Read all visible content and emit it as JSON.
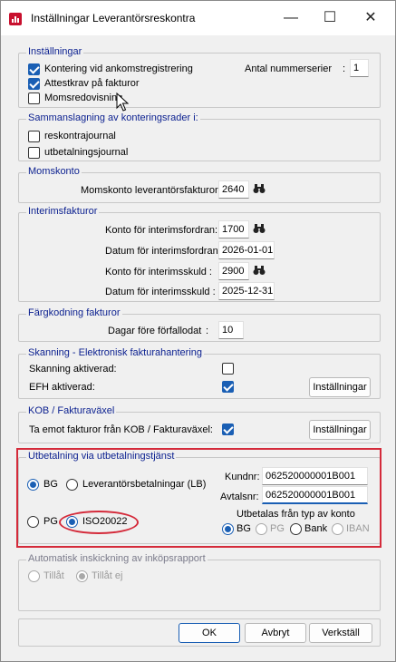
{
  "window": {
    "title": "Inställningar Leverantörsreskontra",
    "minimize_glyph": "—",
    "maximize_glyph": "☐",
    "close_glyph": "✕"
  },
  "installningar": {
    "title": "Inställningar",
    "kontering_label": "Kontering vid ankomstregistrering",
    "kontering_checked": true,
    "attestkrav_label": "Attestkrav på fakturor",
    "attestkrav_checked": true,
    "momsredovisning_label": "Momsredovisning",
    "momsredovisning_checked": false,
    "antal_label": "Antal nummerserier",
    "antal_colon": ":",
    "antal_value": "1"
  },
  "sammanslagning": {
    "title": "Sammanslagning av konteringsrader i:",
    "reskontra_label": "reskontrajournal",
    "utbetalning_label": "utbetalningsjournal"
  },
  "momskonto": {
    "title": "Momskonto",
    "label": "Momskonto leverantörsfakturor:",
    "value": "2640"
  },
  "interims": {
    "title": "Interimsfakturor",
    "konto_fordran_label": "Konto för interimsfordran:",
    "konto_fordran_value": "1700",
    "datum_fordran_label": "Datum för interimsfordran:",
    "datum_fordran_value": "2026-01-01",
    "konto_skuld_label": "Konto för interimsskuld :",
    "konto_skuld_value": "2900",
    "datum_skuld_label": "Datum för interimsskuld :",
    "datum_skuld_value": "2025-12-31"
  },
  "fargkodning": {
    "title": "Färgkodning fakturor",
    "label": "Dagar före förfallodat",
    "colon": ":",
    "value": "10"
  },
  "skanning": {
    "title": "Skanning -  Elektronisk fakturahantering",
    "aktiverad_label": "Skanning aktiverad:",
    "aktiverad_checked": false,
    "efh_label": "EFH aktiverad:",
    "efh_checked": true,
    "installningar_button": "Inställningar"
  },
  "kob": {
    "title": "KOB / Fakturaväxel",
    "label": "Ta emot fakturor från KOB / Fakturaväxel:",
    "checked": true,
    "installningar_button": "Inställningar"
  },
  "utbetalning": {
    "title": "Utbetalning via utbetalningstjänst",
    "bg_label": "BG",
    "lb_label": "Leverantörsbetalningar (LB)",
    "pg_label": "PG",
    "iso_label": "ISO20022",
    "kundnr_label": "Kundnr:",
    "kundnr_value": "062520000001B001",
    "avtalsnr_label": "Avtalsnr:",
    "avtalsnr_value": "062520000001B001",
    "typ_label": "Utbetalas från typ av konto",
    "typ_bg": "BG",
    "typ_pg": "PG",
    "typ_bank": "Bank",
    "typ_iban": "IBAN"
  },
  "automatisk": {
    "title": "Automatisk inskickning av inköpsrapport",
    "tillat_label": "Tillåt",
    "tillat_ej_label": "Tillåt ej"
  },
  "footer": {
    "ok_label": "OK",
    "avbryt_label": "Avbryt",
    "verkstall_label": "Verkställ"
  },
  "colors": {
    "accent": "#1a5fb4",
    "highlight": "#d42a3a",
    "group_title": "#0a1f8f"
  }
}
